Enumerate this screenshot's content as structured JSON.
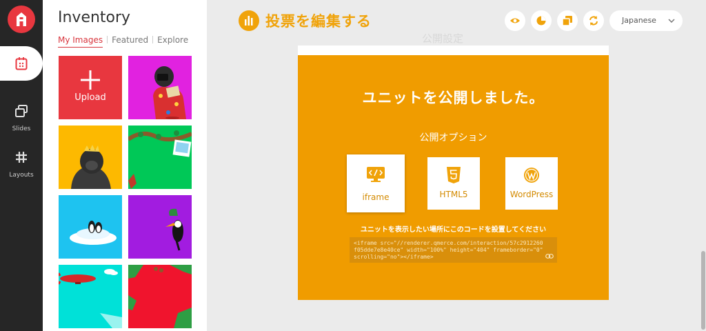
{
  "rail": {
    "items": [
      {
        "icon": "slides-icon",
        "label": "Slides"
      },
      {
        "icon": "layouts-icon",
        "label": "Layouts"
      }
    ]
  },
  "inventory": {
    "title": "Inventory",
    "tabs": [
      "My Images",
      "Featured",
      "Explore"
    ],
    "active_tab": "My Images",
    "upload_label": "Upload",
    "tiles": [
      {
        "kind": "upload",
        "color": "#e8373f"
      },
      {
        "kind": "image",
        "subject": "gorilla-with-camera",
        "color": "#e122e0"
      },
      {
        "kind": "image",
        "subject": "gorilla-with-crown",
        "color": "#fdb900"
      },
      {
        "kind": "image",
        "subject": "jungle-vines-with-photo",
        "color": "#00c857"
      },
      {
        "kind": "image",
        "subject": "penguins-on-iceberg",
        "color": "#1ec3f0"
      },
      {
        "kind": "image",
        "subject": "toucan",
        "color": "#a21ce0"
      },
      {
        "kind": "image",
        "subject": "blimp-and-clouds",
        "color": "#00e1d8"
      },
      {
        "kind": "image",
        "subject": "jungle-leaves-frame",
        "color": "#f0142d"
      }
    ]
  },
  "toolbar": {
    "title": "投票を編集する",
    "buttons": [
      "eye-icon",
      "pie-chart-icon",
      "duplicate-icon",
      "refresh-icon"
    ],
    "language": "Japanese",
    "accent": "#f0a30a"
  },
  "preview": {
    "ghost_heading": "公開設定",
    "headline": "ユニットを公開しました。",
    "subheading": "公開オプション",
    "options": [
      {
        "label": "iframe",
        "icon": "code-monitor-icon",
        "selected": true
      },
      {
        "label": "HTML5",
        "icon": "html5-icon",
        "selected": false
      },
      {
        "label": "WordPress",
        "icon": "wordpress-icon",
        "selected": false
      }
    ],
    "instruction": "ユニットを表示したい場所にこのコードを設置してください",
    "embed_code": "<iframe src=\"//renderer.qmerce.com/interaction/57c2912260f05dde7e8e40ce\"  width=\"100%\" height=\"404\" frameborder=\"0\" scrolling=\"no\"></iframe>",
    "background": "#f09c00"
  }
}
